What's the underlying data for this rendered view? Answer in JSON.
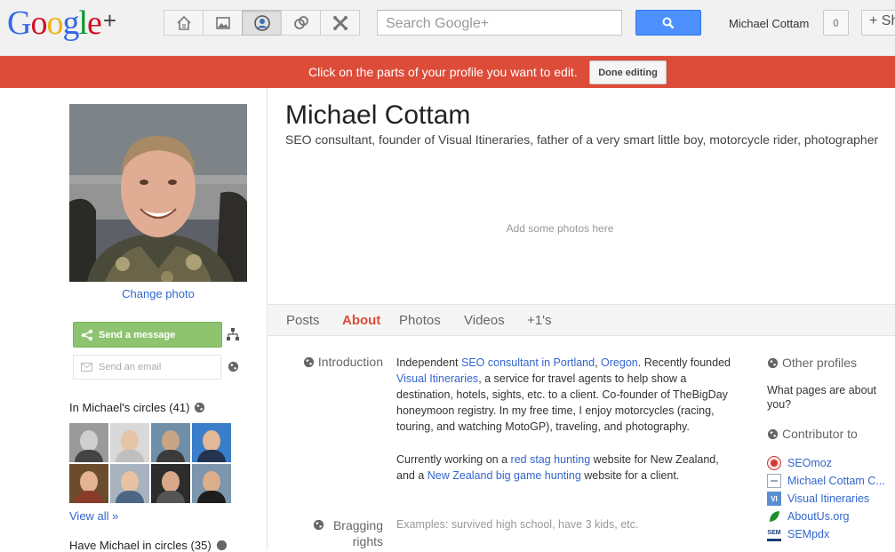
{
  "header": {
    "logo_text": "Google+",
    "search_placeholder": "Search Google+",
    "username": "Michael Cottam",
    "notification_count": "0",
    "share_label": "+ Sh"
  },
  "nav": [
    {
      "icon": "home-icon",
      "active": false
    },
    {
      "icon": "photos-icon",
      "active": false
    },
    {
      "icon": "profile-icon",
      "active": true
    },
    {
      "icon": "circles-icon",
      "active": false
    },
    {
      "icon": "games-icon",
      "active": false
    }
  ],
  "banner": {
    "text": "Click on the parts of your profile you want to edit.",
    "done_label": "Done editing"
  },
  "sidebar": {
    "change_photo": "Change photo",
    "send_message": "Send a message",
    "send_email": "Send an email",
    "in_circles": "In Michael's circles (41)",
    "view_all": "View all »",
    "have_in_circles": "Have Michael in circles (35)"
  },
  "profile": {
    "name": "Michael Cottam",
    "tagline": "SEO consultant, founder of Visual Itineraries, father of a very smart little boy, motorcycle rider, photographer",
    "add_photos": "Add some photos here"
  },
  "tabs": [
    "Posts",
    "About",
    "Photos",
    "Videos",
    "+1's"
  ],
  "active_tab": "About",
  "about": {
    "introduction_label": "Introduction",
    "intro_p1": {
      "t1": "Independent ",
      "link1": "SEO consultant in Portland",
      "t2": ", ",
      "link2": "Oregon",
      "t3": ".  Recently founded ",
      "link3": "Visual Itineraries",
      "t4": ", a service for travel agents to help show a destination, hotels, sights, etc. to a client. Co-founder of TheBigDay honeymoon registry. In my free time, I enjoy motorcycles (racing, touring, and watching MotoGP), traveling, and photography."
    },
    "intro_p2": {
      "t1": "Currently working on a ",
      "link1": "red stag hunting",
      "t2": " website for New Zealand, and a ",
      "link2": "New Zealand big game hunting",
      "t3": " website for a client."
    },
    "bragging_label": "Bragging rights",
    "bragging_placeholder": "Examples: survived high school, have 3 kids, etc."
  },
  "side": {
    "other_profiles": "Other profiles",
    "question": "What pages are about you?",
    "contributor_to": "Contributor to",
    "links": [
      {
        "label": "SEOmoz",
        "icon": "seomoz-icon"
      },
      {
        "label": "Michael Cottam C...",
        "icon": "page-icon"
      },
      {
        "label": "Visual Itineraries",
        "icon": "vi-icon"
      },
      {
        "label": "AboutUs.org",
        "icon": "leaf-icon"
      },
      {
        "label": "SEMpdx",
        "icon": "sempdx-icon"
      }
    ]
  },
  "colors": {
    "banner": "#dd4b39",
    "active_tab": "#dd4b39",
    "link": "#3366cc",
    "send_message": "#8ec470",
    "search_button": "#4d90fe"
  }
}
